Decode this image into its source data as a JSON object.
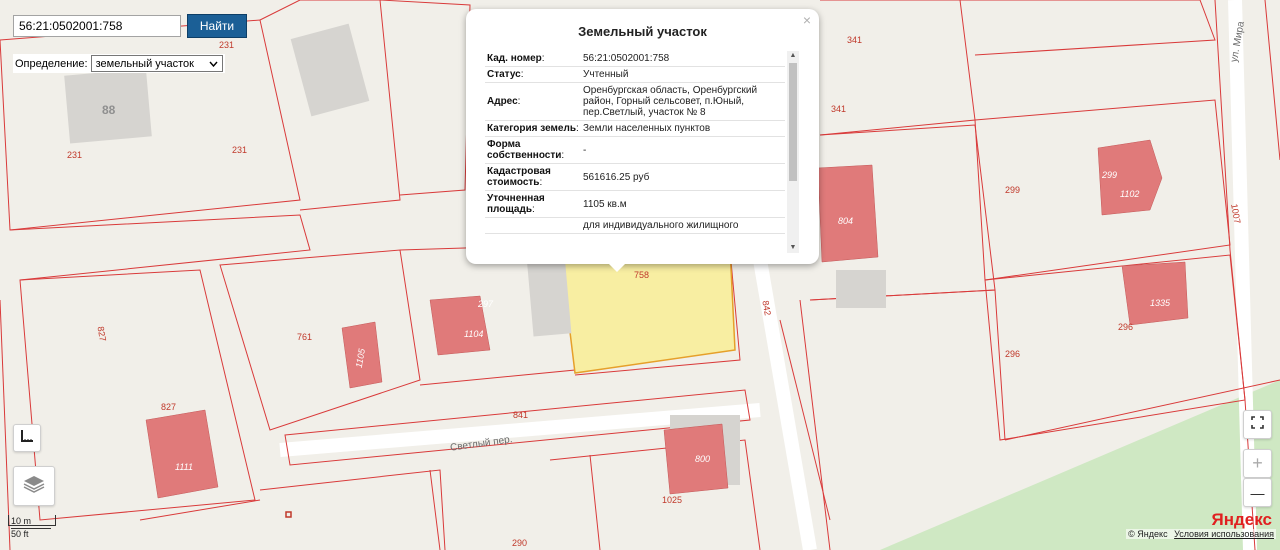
{
  "search": {
    "value": "56:21:0502001:758",
    "button_label": "Найти"
  },
  "definition": {
    "label": "Определение:",
    "selected": "земельный участок"
  },
  "popup": {
    "close": "×",
    "title": "Земельный участок",
    "rows": [
      {
        "key": "Кад. номер",
        "colon": ":",
        "value": "56:21:0502001:758"
      },
      {
        "key": "Статус",
        "colon": ":",
        "value": "Учтенный"
      },
      {
        "key": "Адрес",
        "colon": ":",
        "value": "Оренбургская область, Оренбургский район, Горный сельсовет, п.Юный, пер.Светлый, участок № 8"
      },
      {
        "key": "Категория земель",
        "colon": ":",
        "value": "Земли населенных пунктов"
      },
      {
        "key": "Форма собственности",
        "colon": ":",
        "value": "-"
      },
      {
        "key": "Кадастровая стоимость",
        "colon": ":",
        "value": "561616.25 руб"
      },
      {
        "key": "Уточненная площадь",
        "colon": ":",
        "value": "1105 кв.м"
      },
      {
        "key": "",
        "colon": "",
        "value": "для индивидуального жилищного"
      }
    ]
  },
  "map": {
    "parcel_labels": [
      "231",
      "231",
      "231",
      "341",
      "341",
      "299",
      "296",
      "296",
      "761",
      "827",
      "827",
      "841",
      "842",
      "1025",
      "290",
      "1007",
      "758"
    ],
    "building_labels": [
      "1104",
      "1105",
      "1111",
      "800",
      "804",
      "1102",
      "1335",
      "299",
      "297"
    ],
    "building_gray_label": "88",
    "street_labels": [
      "Светлый пер.",
      "ул. Мира"
    ],
    "colors": {
      "parcel_line": "#d93a3a",
      "building": "#e07a7a",
      "selected_parcel": "#f8eea2",
      "selected_border": "#e6a02a"
    }
  },
  "scale": {
    "meters": "10 m",
    "feet": "50 ft"
  },
  "controls": {
    "zoom_in": "+",
    "zoom_out": "—"
  },
  "brand": "Яндекс",
  "copyright": {
    "text": "© Яндекс",
    "terms": "Условия использования"
  }
}
